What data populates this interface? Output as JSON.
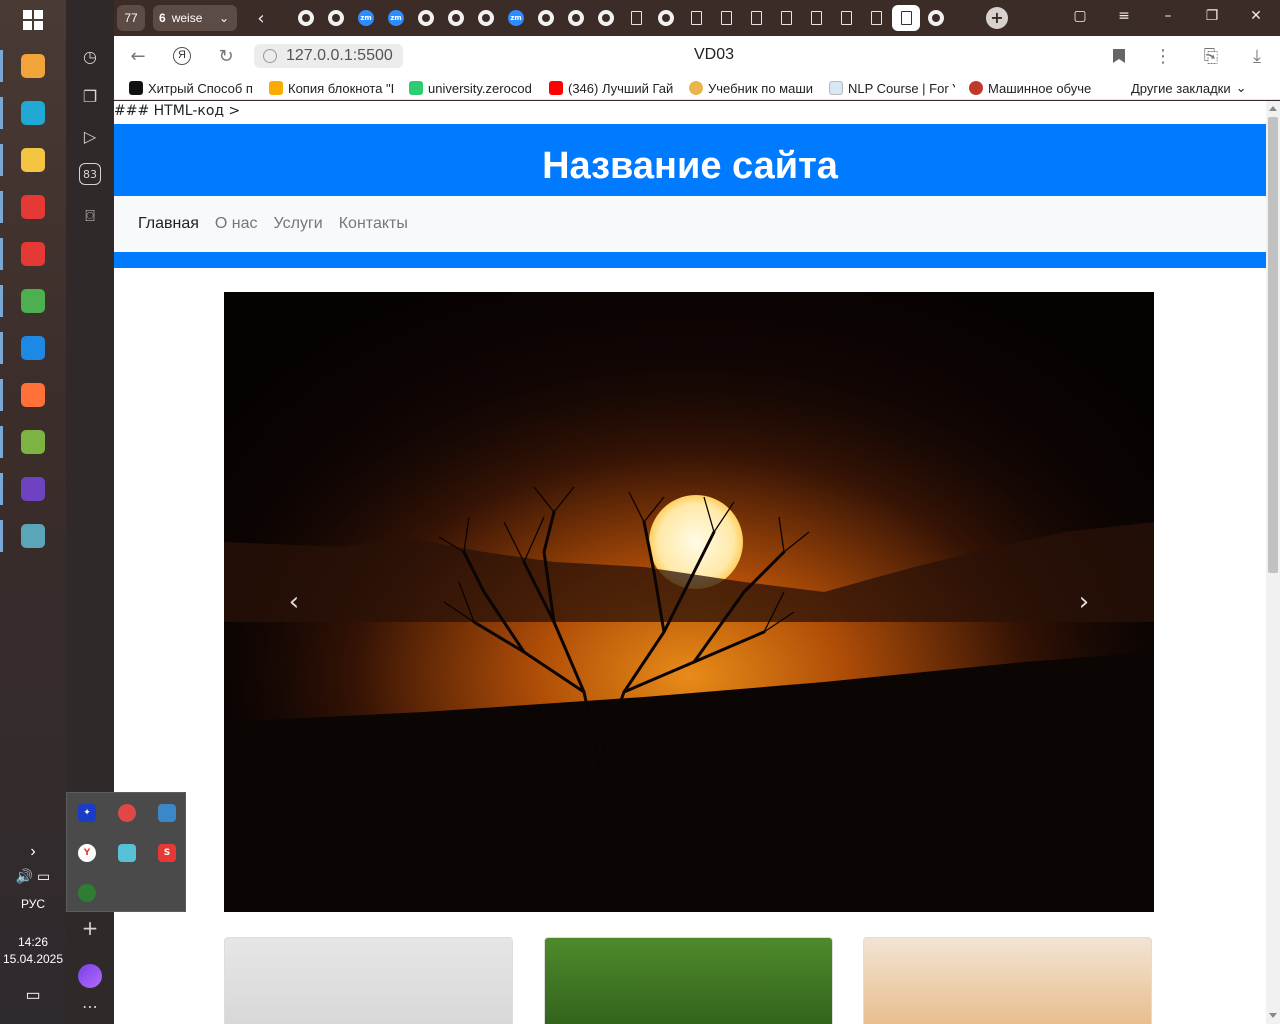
{
  "taskbar": {
    "apps": [
      {
        "name": "media-player-icon",
        "color": "#f2a33a"
      },
      {
        "name": "edge-icon",
        "color": "#1fa9d4"
      },
      {
        "name": "file-explorer-icon",
        "color": "#f4c542"
      },
      {
        "name": "yandex-icon",
        "color": "#e53935"
      },
      {
        "name": "yandex-browser-icon",
        "color": "#e53935"
      },
      {
        "name": "chrome-icon",
        "color": "#4caf50"
      },
      {
        "name": "vscode-icon",
        "color": "#1e88e5"
      },
      {
        "name": "firefox-icon",
        "color": "#ff7139"
      },
      {
        "name": "notepad-icon",
        "color": "#7cb342"
      },
      {
        "name": "github-desktop-icon",
        "color": "#6f42c1"
      },
      {
        "name": "app-bird-icon",
        "color": "#5aa6b8"
      }
    ],
    "language": "РУС",
    "time": "14:26",
    "date": "15.04.2025"
  },
  "browser": {
    "tab_count": "77",
    "tab_group_count": "6",
    "tab_group_label": "weise",
    "sidebar_badge": "83",
    "url": "127.0.0.1:5500",
    "page_title": "VD03",
    "bookmarks": [
      "Хитрый Способ п",
      "Копия блокнота \"I",
      "university.zerocod",
      "(346) Лучший Гай",
      "Учебник по маши",
      "NLP Course | For Y",
      "Машинное обуче"
    ],
    "bookmarks_more": "Другие закладки"
  },
  "page": {
    "stray_text": "### HTML-код >",
    "site_title": "Название сайта",
    "nav": [
      "Главная",
      "О нас",
      "Услуги",
      "Контакты"
    ],
    "carousel_prev": "‹",
    "carousel_next": "›"
  },
  "colors": {
    "primary": "#007bff",
    "nav_bg": "#f8f9fa"
  }
}
